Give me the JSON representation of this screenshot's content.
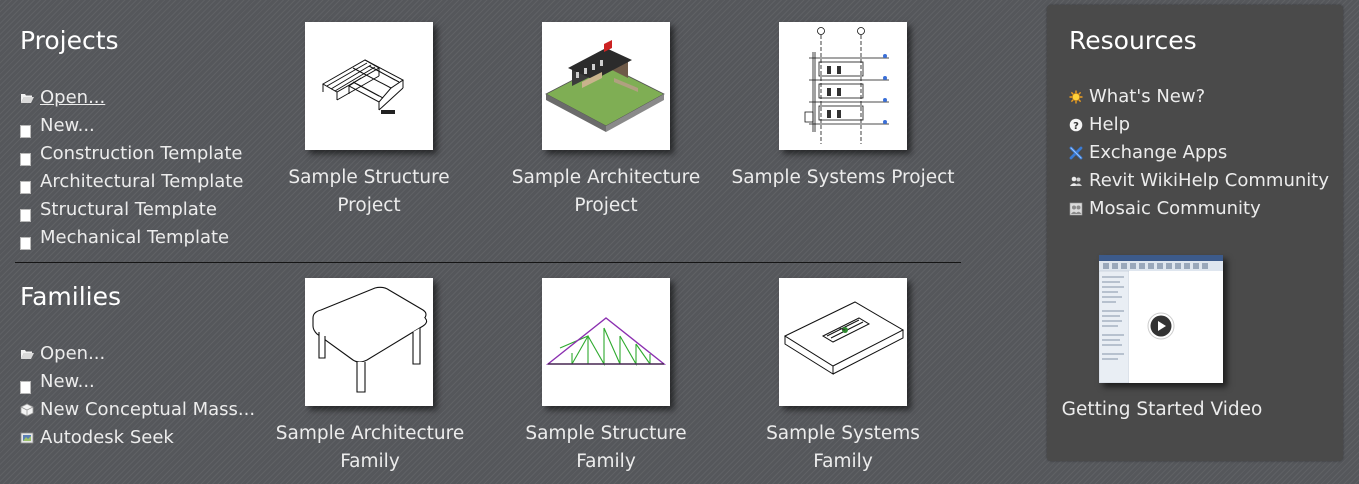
{
  "projects": {
    "heading": "Projects",
    "links": [
      {
        "label": "Open...",
        "icon": "folder-open-icon"
      },
      {
        "label": "New...",
        "icon": "document-icon"
      },
      {
        "label": "Construction Template",
        "icon": "document-icon"
      },
      {
        "label": "Architectural Template",
        "icon": "document-icon"
      },
      {
        "label": "Structural Template",
        "icon": "document-icon"
      },
      {
        "label": "Mechanical Template",
        "icon": "document-icon"
      }
    ],
    "samples": [
      {
        "label": "Sample Structure Project",
        "icon": "structure-model-icon"
      },
      {
        "label": "Sample Architecture Project",
        "icon": "architecture-model-icon"
      },
      {
        "label": "Sample Systems Project",
        "icon": "systems-section-icon"
      }
    ]
  },
  "families": {
    "heading": "Families",
    "links": [
      {
        "label": "Open...",
        "icon": "folder-open-icon"
      },
      {
        "label": "New...",
        "icon": "document-icon"
      },
      {
        "label": "New Conceptual Mass...",
        "icon": "cube-icon"
      },
      {
        "label": "Autodesk Seek",
        "icon": "seek-icon"
      }
    ],
    "samples": [
      {
        "label": "Sample Architecture Family",
        "icon": "table-icon"
      },
      {
        "label": "Sample Structure Family",
        "icon": "truss-icon"
      },
      {
        "label": "Sample Systems Family",
        "icon": "diffuser-icon"
      }
    ]
  },
  "resources": {
    "heading": "Resources",
    "links": [
      {
        "label": "What's New?",
        "icon": "sun-icon"
      },
      {
        "label": "Help",
        "icon": "help-icon"
      },
      {
        "label": "Exchange Apps",
        "icon": "exchange-icon"
      },
      {
        "label": "Revit WikiHelp Community",
        "icon": "community-icon"
      },
      {
        "label": "Mosaic Community",
        "icon": "mosaic-icon"
      }
    ],
    "video": {
      "label": "Getting Started Video",
      "icon": "play-icon"
    }
  }
}
